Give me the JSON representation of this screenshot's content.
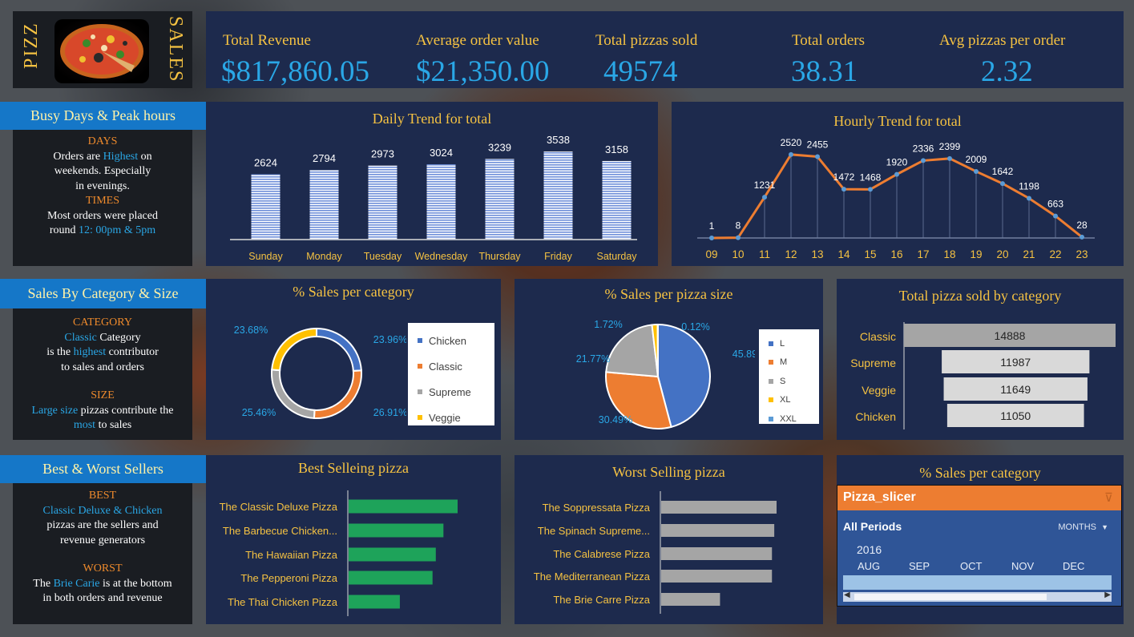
{
  "logo": {
    "left_text": "PIZZ",
    "right_text": "SALES"
  },
  "kpis": [
    {
      "label": "Total Revenue",
      "value": "$817,860.05"
    },
    {
      "label": "Average order value",
      "value": "$21,350.00"
    },
    {
      "label": "Total pizzas sold",
      "value": "49574"
    },
    {
      "label": "Total orders",
      "value": "38.31"
    },
    {
      "label": "Avg pizzas per order",
      "value": "2.32"
    }
  ],
  "sections": {
    "busy": {
      "title": "Busy Days & Peak hours",
      "days_h": "DAYS",
      "days_1a": "Orders are ",
      "days_1b": "Highest",
      "days_1c": " on",
      "days_2": "weekends. Especially",
      "days_3": "in evenings.",
      "times_h": "TIMES",
      "times_1": "Most orders were placed",
      "times_2a": "round ",
      "times_2b": "12: 00pm & 5pm"
    },
    "category": {
      "title": "Sales By Category  & Size",
      "cat_h": "CATEGORY",
      "cat_1a": "Classic",
      "cat_1b": " Category",
      "cat_2a": "is the ",
      "cat_2b": "highest",
      "cat_2c": " contributor",
      "cat_3": "to sales and orders",
      "size_h": "SIZE",
      "size_1a": "Large size",
      "size_1b": " pizzas contribute  the",
      "size_2a": "most",
      "size_2b": " to sales"
    },
    "best": {
      "title": "Best & Worst Sellers",
      "best_h": "BEST",
      "best_1": "Classic  Deluxe  & Chicken",
      "best_2": "pizzas  are the sellers  and",
      "best_3": "revenue  generators",
      "worst_h": "WORST",
      "worst_1a": "The ",
      "worst_1b": "Brie Carie",
      "worst_1c": " is at the bottom",
      "worst_2": "in both orders and revenue"
    }
  },
  "chart_titles": {
    "daily": "Daily Trend for total",
    "hourly": "Hourly Trend for total",
    "cat_pct": "% Sales per category",
    "size_pct": "% Sales per pizza size",
    "sold_cat": "Total pizza sold by category",
    "best": "Best Selleing pizza",
    "worst": "Worst Selling pizza",
    "slicer_panel": "% Sales per category"
  },
  "chart_data": [
    {
      "id": "daily",
      "type": "bar",
      "categories": [
        "Sunday",
        "Monday",
        "Tuesday",
        "Wednesday",
        "Thursday",
        "Friday",
        "Saturday"
      ],
      "values": [
        2624,
        2794,
        2973,
        3024,
        3239,
        3538,
        3158
      ],
      "title": "Daily Trend for total",
      "ylim": [
        0,
        3800
      ],
      "color": "#6f8fd9"
    },
    {
      "id": "hourly",
      "type": "line",
      "x": [
        "09",
        "10",
        "11",
        "12",
        "13",
        "14",
        "15",
        "16",
        "17",
        "18",
        "19",
        "20",
        "21",
        "22",
        "23"
      ],
      "values": [
        1,
        8,
        1231,
        2520,
        2455,
        1472,
        1468,
        1920,
        2336,
        2399,
        2009,
        1642,
        1198,
        663,
        28
      ],
      "title": "Hourly Trend for total",
      "ylim": [
        0,
        3000
      ],
      "color": "#ed7d31"
    },
    {
      "id": "cat_pct",
      "type": "pie",
      "donut": true,
      "title": "% Sales per category",
      "series": [
        {
          "name": "Chicken",
          "value": 23.96,
          "label": "23.96%",
          "color": "#4472c4"
        },
        {
          "name": "Classic",
          "value": 26.91,
          "label": "26.91%",
          "color": "#ed7d31"
        },
        {
          "name": "Supreme",
          "value": 25.46,
          "label": "25.46%",
          "color": "#a5a5a5"
        },
        {
          "name": "Veggie",
          "value": 23.68,
          "label": "23.68%",
          "color": "#ffc000"
        }
      ]
    },
    {
      "id": "size_pct",
      "type": "pie",
      "donut": false,
      "title": "% Sales per pizza size",
      "series": [
        {
          "name": "L",
          "value": 45.89,
          "label": "45.89%",
          "color": "#4472c4"
        },
        {
          "name": "M",
          "value": 30.49,
          "label": "30.49%",
          "color": "#ed7d31"
        },
        {
          "name": "S",
          "value": 21.77,
          "label": "21.77%",
          "color": "#a5a5a5"
        },
        {
          "name": "XL",
          "value": 1.72,
          "label": "1.72%",
          "color": "#ffc000"
        },
        {
          "name": "XXL",
          "value": 0.12,
          "label": "0.12%",
          "color": "#5b9bd5"
        }
      ]
    },
    {
      "id": "sold_cat",
      "type": "bar",
      "orientation": "horizontal",
      "title": "Total pizza sold by category",
      "categories": [
        "Classic",
        "Supreme",
        "Veggie",
        "Chicken"
      ],
      "values": [
        14888,
        11987,
        11649,
        11050
      ]
    },
    {
      "id": "best",
      "type": "bar",
      "orientation": "horizontal",
      "title": "Best Selleing pizza",
      "categories": [
        "The Classic Deluxe Pizza",
        "The Barbecue Chicken...",
        "The Hawaiian Pizza",
        "The Pepperoni Pizza",
        "The Thai Chicken Pizza"
      ],
      "values": [
        100,
        87,
        80,
        77,
        47
      ],
      "color": "#1ea35a"
    },
    {
      "id": "worst",
      "type": "bar",
      "orientation": "horizontal",
      "title": "Worst Selling pizza",
      "categories": [
        "The Soppressata Pizza",
        "The Spinach Supreme...",
        "The Calabrese Pizza",
        "The Mediterranean Pizza",
        "The Brie Carre Pizza"
      ],
      "values": [
        100,
        98,
        96,
        96,
        51
      ],
      "color": "#a5a5a5"
    }
  ],
  "slicer": {
    "name": "Pizza_slicer",
    "period": "All Periods",
    "granularity": "MONTHS",
    "year": "2016",
    "months": [
      "AUG",
      "SEP",
      "OCT",
      "NOV",
      "DEC"
    ]
  }
}
